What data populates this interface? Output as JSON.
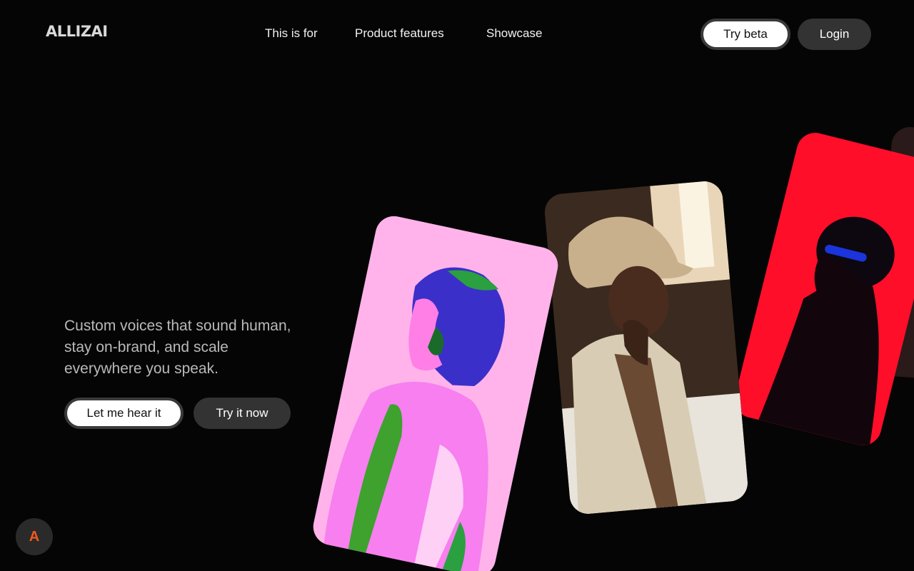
{
  "header": {
    "logo": "ALLIZAI",
    "nav": [
      {
        "label": "This is for"
      },
      {
        "label": "Product features"
      },
      {
        "label": "Showcase"
      }
    ],
    "try_beta_label": "Try beta",
    "login_label": "Login"
  },
  "hero": {
    "tagline": "Custom voices that sound human, stay on-brand, and scale everywhere you speak.",
    "primary_cta": "Let me hear it",
    "secondary_cta": "Try it now"
  },
  "fab": {
    "label": "A",
    "accent": "#f05a1a"
  },
  "colors": {
    "background": "#050505",
    "card_pink": "#ffb3ea",
    "card_red": "#ff0e2a",
    "button_dark": "#333333"
  }
}
